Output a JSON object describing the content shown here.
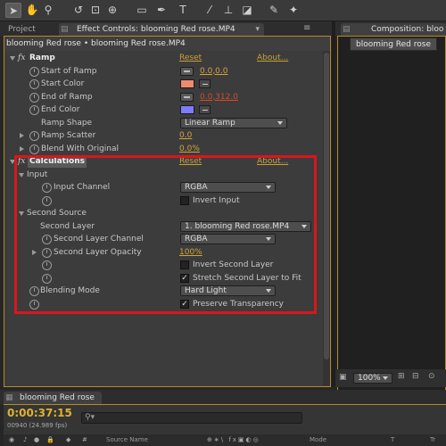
{
  "toolbar": {
    "tools": [
      "selection-tool",
      "hand-tool",
      "zoom-tool",
      "rotate-tool",
      "camera-orbit-tool",
      "pan-behind-tool",
      "rectangle-tool",
      "pen-tool",
      "type-tool",
      "brush-tool",
      "clone-stamp-tool",
      "eraser-tool",
      "roto-brush-tool",
      "puppet-pin-tool"
    ]
  },
  "tabs": {
    "project": "Project",
    "effect_controls": "Effect Controls: blooming Red rose.MP4",
    "composition": "Composition: bloo"
  },
  "ec_header": "blooming Red rose • blooming Red rose.MP4",
  "ramp": {
    "name": "Ramp",
    "reset": "Reset",
    "about": "About...",
    "start_of_ramp_label": "Start of Ramp",
    "start_of_ramp_value": "0.0,0.0",
    "start_color_label": "Start Color",
    "start_color": "#f08a6e",
    "end_of_ramp_label": "End of Ramp",
    "end_of_ramp_value": "0.0,312.0",
    "end_color_label": "End Color",
    "end_color": "#7f7bff",
    "ramp_shape_label": "Ramp Shape",
    "ramp_shape_value": "Linear Ramp",
    "ramp_scatter_label": "Ramp Scatter",
    "ramp_scatter_value": "0.0",
    "blend_label": "Blend With Original",
    "blend_value": "0.0%"
  },
  "calculations": {
    "name": "Calculations",
    "reset": "Reset",
    "about": "About...",
    "input_label": "Input",
    "input_channel_label": "Input Channel",
    "input_channel_value": "RGBA",
    "invert_input_label": "Invert Input",
    "invert_input_checked": false,
    "second_source_label": "Second Source",
    "second_layer_label": "Second Layer",
    "second_layer_value": "1. blooming Red rose.MP4",
    "second_layer_channel_label": "Second Layer Channel",
    "second_layer_channel_value": "RGBA",
    "second_layer_opacity_label": "Second Layer Opacity",
    "second_layer_opacity_value": "100%",
    "invert_second_layer_label": "Invert Second Layer",
    "invert_second_layer_checked": false,
    "stretch_label": "Stretch Second Layer to Fit",
    "stretch_checked": true,
    "blending_mode_label": "Blending Mode",
    "blending_mode_value": "Hard Light",
    "preserve_label": "Preserve Transparency",
    "preserve_checked": true
  },
  "composition": {
    "chip": "blooming Red rose",
    "zoom": "100%"
  },
  "timeline": {
    "tab": "blooming Red rose",
    "timecode": "0:00:37:15",
    "fps_line": "00940 (24.989 fps)",
    "search_placeholder": "",
    "col_source_name": "Source Name",
    "col_mode": "Mode",
    "col_t": "T",
    "col_trk": "Tr"
  },
  "colors": {
    "accent_frame": "#b58a2a",
    "highlight_box": "#d9161d",
    "value_link": "#d4a33a"
  }
}
